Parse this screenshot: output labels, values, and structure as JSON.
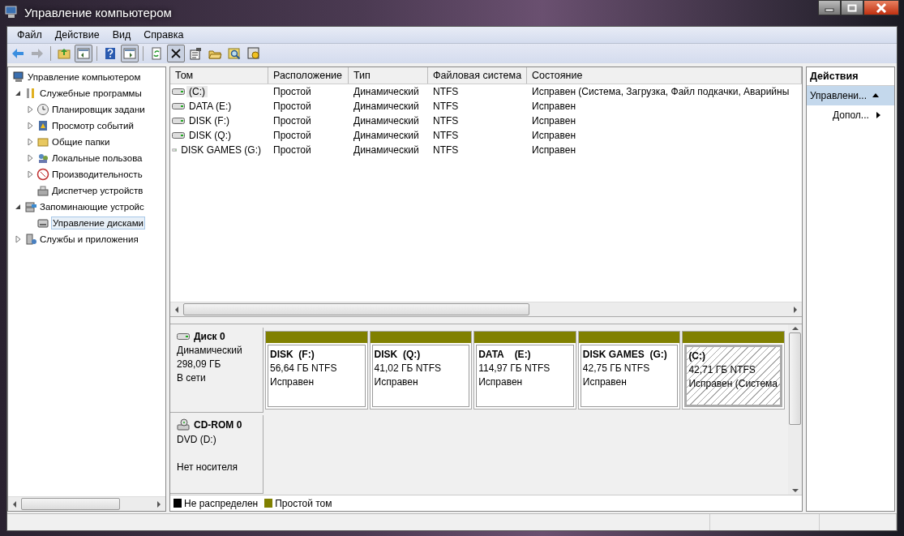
{
  "window": {
    "title": "Управление компьютером"
  },
  "menu": [
    "Файл",
    "Действие",
    "Вид",
    "Справка"
  ],
  "toolbar": [
    {
      "pressed": false,
      "disabled": false
    },
    {
      "pressed": false,
      "disabled": true
    },
    {
      "pressed": false,
      "disabled": false
    },
    {
      "pressed": true,
      "disabled": false
    },
    {
      "pressed": false,
      "disabled": false
    },
    {
      "pressed": true,
      "disabled": false
    },
    {
      "pressed": false,
      "disabled": false
    },
    {
      "pressed": true,
      "disabled": false
    },
    {
      "pressed": false,
      "disabled": false
    },
    {
      "pressed": false,
      "disabled": false
    },
    {
      "pressed": false,
      "disabled": false
    },
    {
      "pressed": false,
      "disabled": false
    }
  ],
  "tree": [
    {
      "label": "Управление компьютером",
      "selected": false,
      "children": [
        {
          "label": "Служебные программы",
          "expanded": true,
          "selected": false,
          "children": [
            {
              "label": "Планировщик задани",
              "expanded": false,
              "selected": false
            },
            {
              "label": "Просмотр событий",
              "expanded": false,
              "selected": false
            },
            {
              "label": "Общие папки",
              "expanded": false,
              "selected": false
            },
            {
              "label": "Локальные пользова",
              "expanded": false,
              "selected": false
            },
            {
              "label": "Производительность",
              "expanded": false,
              "selected": false
            },
            {
              "label": "Диспетчер устройств",
              "selected": false
            }
          ]
        },
        {
          "label": "Запоминающие устройс",
          "expanded": true,
          "selected": false,
          "children": [
            {
              "label": "Управление дисками",
              "selected": true
            }
          ]
        },
        {
          "label": "Службы и приложения",
          "expanded": false,
          "selected": false
        }
      ]
    }
  ],
  "table": {
    "columns": [
      "Том",
      "Расположение",
      "Тип",
      "Файловая система",
      "Состояние"
    ],
    "rows": [
      {
        "selected": true,
        "cells": [
          "(C:)",
          "Простой",
          "Динамический",
          "NTFS",
          "Исправен (Система, Загрузка, Файл подкачки, Аварийны"
        ]
      },
      {
        "selected": false,
        "cells": [
          "DATA  (E:)",
          "Простой",
          "Динамический",
          "NTFS",
          "Исправен"
        ]
      },
      {
        "selected": false,
        "cells": [
          "DISK (F:)",
          "Простой",
          "Динамический",
          "NTFS",
          "Исправен"
        ]
      },
      {
        "selected": false,
        "cells": [
          "DISK (Q:)",
          "Простой",
          "Динамический",
          "NTFS",
          "Исправен"
        ]
      },
      {
        "selected": false,
        "cells": [
          "DISK GAMES (G:)",
          "Простой",
          "Динамический",
          "NTFS",
          "Исправен"
        ]
      }
    ]
  },
  "disks": [
    {
      "kind": "disk",
      "name": "Диск 0",
      "lines": [
        "Динамический",
        "298,09 ГБ",
        "В сети"
      ],
      "partitions": [
        {
          "name": "DISK  (F:)",
          "size": "56,64 ГБ NTFS",
          "status": "Исправен",
          "selected": false
        },
        {
          "name": "DISK  (Q:)",
          "size": "41,02 ГБ NTFS",
          "status": "Исправен",
          "selected": false
        },
        {
          "name": "DATA    (E:)",
          "size": "114,97 ГБ NTFS",
          "status": "Исправен",
          "selected": false
        },
        {
          "name": "DISK GAMES  (G:)",
          "size": "42,75 ГБ NTFS",
          "status": "Исправен",
          "selected": false
        },
        {
          "name": "(C:)",
          "size": "42,71 ГБ NTFS",
          "status": "Исправен (Система",
          "selected": true
        }
      ]
    },
    {
      "kind": "cdrom",
      "name": "CD-ROM 0",
      "lines": [
        "DVD (D:)",
        "Нет носителя"
      ]
    }
  ],
  "legend": [
    {
      "label": "Не распределен",
      "color": "#000000"
    },
    {
      "label": "Простой том",
      "color": "#808000"
    }
  ],
  "actions": {
    "title": "Действия",
    "items": [
      {
        "label": "Управлени...",
        "kind": "section",
        "expanded": true
      },
      {
        "label": "Допол...",
        "kind": "submenu",
        "expanded": false
      }
    ]
  }
}
